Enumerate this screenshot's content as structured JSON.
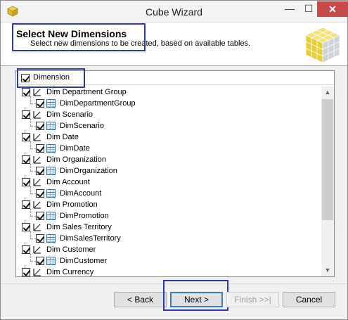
{
  "window": {
    "title": "Cube Wizard",
    "minimize_glyph": "—",
    "maximize_glyph": "☐",
    "close_glyph": "✕"
  },
  "header": {
    "title": "Select New Dimensions",
    "subtitle": "Select new dimensions to be created, based on available tables."
  },
  "tree": {
    "root_label": "Dimension",
    "root_checked": true,
    "items": [
      {
        "dimension": "Dim Department Group",
        "table": "DimDepartmentGroup",
        "checked": true
      },
      {
        "dimension": "Dim Scenario",
        "table": "DimScenario",
        "checked": true
      },
      {
        "dimension": "Dim Date",
        "table": "DimDate",
        "checked": true
      },
      {
        "dimension": "Dim Organization",
        "table": "DimOrganization",
        "checked": true
      },
      {
        "dimension": "Dim Account",
        "table": "DimAccount",
        "checked": true
      },
      {
        "dimension": "Dim Promotion",
        "table": "DimPromotion",
        "checked": true
      },
      {
        "dimension": "Dim Sales Territory",
        "table": "DimSalesTerritory",
        "checked": true
      },
      {
        "dimension": "Dim Customer",
        "table": "DimCustomer",
        "checked": true
      },
      {
        "dimension": "Dim Currency",
        "table": "",
        "checked": true
      }
    ]
  },
  "scrollbar": {
    "up_glyph": "▲",
    "down_glyph": "▼"
  },
  "footer": {
    "back_label": "< Back",
    "next_label": "Next >",
    "finish_label": "Finish >>|",
    "cancel_label": "Cancel"
  },
  "colors": {
    "highlight_box": "#3136a8",
    "close_button": "#c74a49"
  },
  "icons": {
    "app": "cube-wizard-icon",
    "dimension": "dimension-icon",
    "table": "table-icon"
  }
}
